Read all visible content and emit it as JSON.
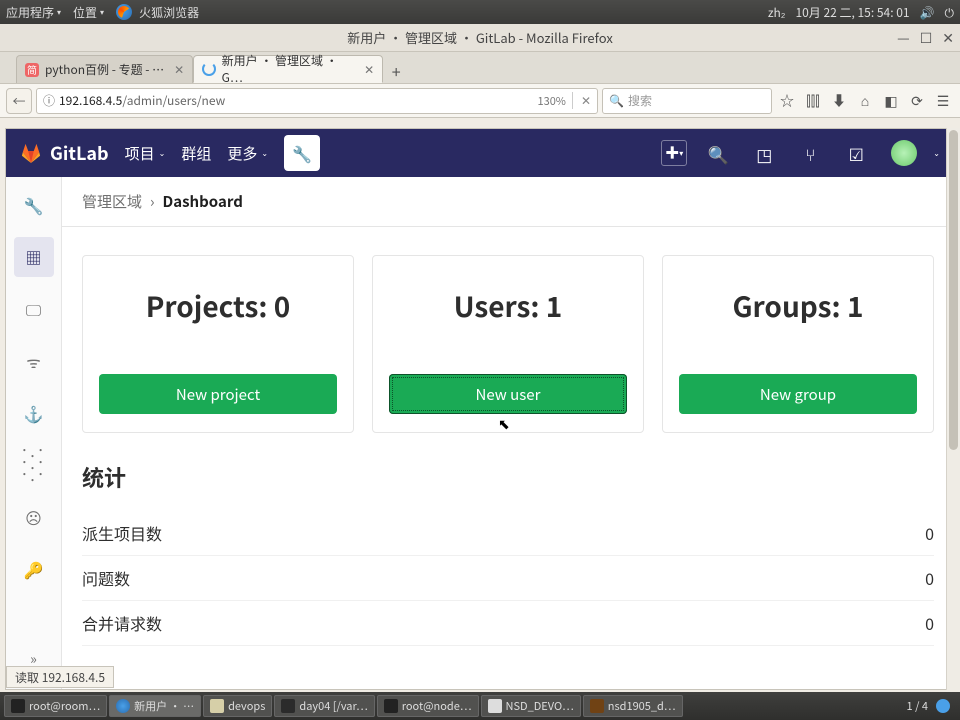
{
  "gnome": {
    "apps": "应用程序",
    "places": "位置",
    "ff": "火狐浏览器",
    "ime": "zh₂",
    "date": "10月  22  二,  15: 54: 01"
  },
  "window": {
    "title": "新用户 · 管理区域 · GitLab - Mozilla Firefox"
  },
  "tabs": {
    "t1": "python百例 - 专题 - …",
    "t2": "新用户 · 管理区域 · G…"
  },
  "url": {
    "host": "192.168.4.5",
    "path": "/admin/users/new",
    "zoom": "130%",
    "search_placeholder": "搜索"
  },
  "gitlab_nav": {
    "brand": "GitLab",
    "projects": "项目",
    "groups": "群组",
    "more": "更多"
  },
  "breadcrumb": {
    "root": "管理区域",
    "current": "Dashboard"
  },
  "cards": {
    "projects": {
      "title": "Projects: 0",
      "btn": "New project"
    },
    "users": {
      "title": "Users: 1",
      "btn": "New user"
    },
    "groups": {
      "title": "Groups: 1",
      "btn": "New group"
    }
  },
  "stats": {
    "heading": "统计",
    "rows": [
      {
        "label": "派生项目数",
        "value": "0"
      },
      {
        "label": "问题数",
        "value": "0"
      },
      {
        "label": "合并请求数",
        "value": "0"
      }
    ]
  },
  "status_bar": "读取 192.168.4.5",
  "taskbar": {
    "items": [
      "root@room…",
      "新用户 · …",
      "devops",
      "day04 [/var…",
      "root@node…",
      "NSD_DEVO…",
      "nsd1905_d…"
    ],
    "pager": "1  /  4"
  }
}
